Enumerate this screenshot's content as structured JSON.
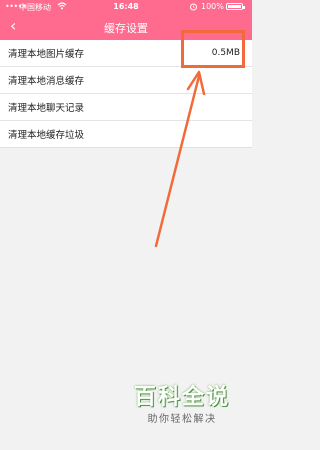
{
  "status_bar": {
    "signal": "•••••",
    "carrier": "中国移动",
    "wifi_icon": "wifi-icon",
    "time": "16:48",
    "alarm_icon": "alarm-icon",
    "battery_percent": "100%",
    "battery_icon": "battery-icon"
  },
  "nav": {
    "back_icon": "chevron-left-icon",
    "back_glyph": "‹",
    "title": "缓存设置",
    "color": "#ff6b8e"
  },
  "list": {
    "items": [
      {
        "label": "清理本地图片缓存",
        "value": "0.5MB"
      },
      {
        "label": "清理本地消息缓存"
      },
      {
        "label": "清理本地聊天记录"
      },
      {
        "label": "清理本地缓存垃圾"
      }
    ]
  },
  "annotation": {
    "color": "#f36a3a"
  },
  "watermark": {
    "main": "百科全说",
    "sub": "助你轻松解决"
  }
}
